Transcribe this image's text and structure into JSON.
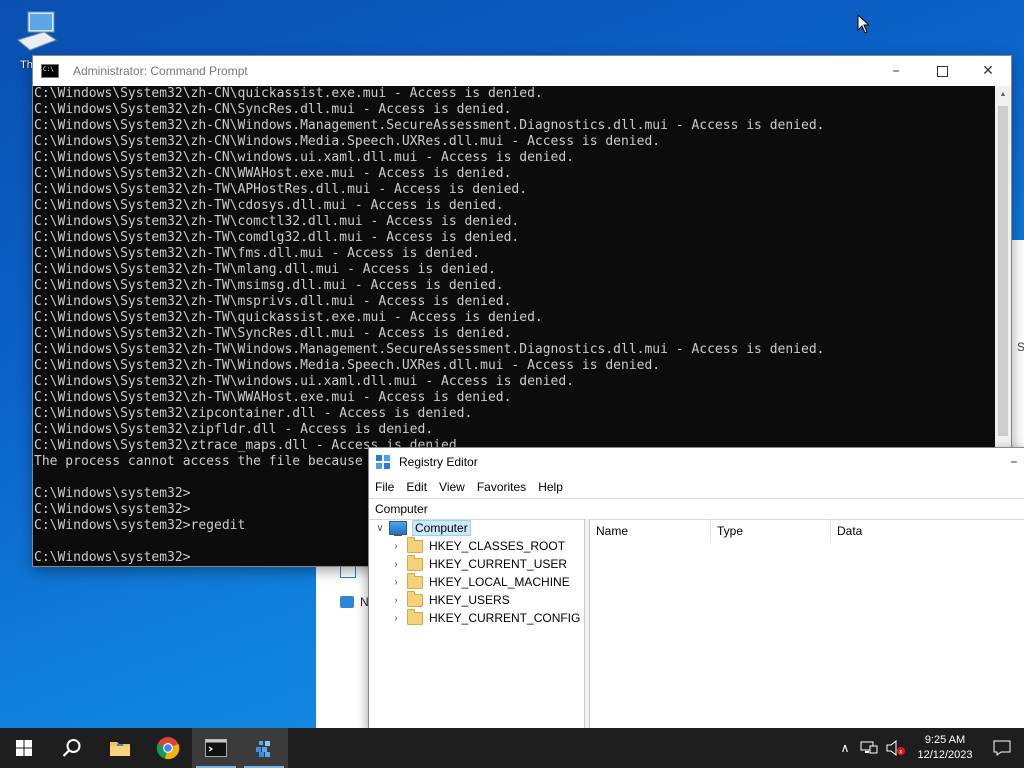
{
  "desktop": {
    "icon_label": "Th"
  },
  "cmd": {
    "title": "Administrator: Command Prompt",
    "lines": [
      "C:\\Windows\\System32\\zh-CN\\quickassist.exe.mui - Access is denied.",
      "C:\\Windows\\System32\\zh-CN\\SyncRes.dll.mui - Access is denied.",
      "C:\\Windows\\System32\\zh-CN\\Windows.Management.SecureAssessment.Diagnostics.dll.mui - Access is denied.",
      "C:\\Windows\\System32\\zh-CN\\Windows.Media.Speech.UXRes.dll.mui - Access is denied.",
      "C:\\Windows\\System32\\zh-CN\\windows.ui.xaml.dll.mui - Access is denied.",
      "C:\\Windows\\System32\\zh-CN\\WWAHost.exe.mui - Access is denied.",
      "C:\\Windows\\System32\\zh-TW\\APHostRes.dll.mui - Access is denied.",
      "C:\\Windows\\System32\\zh-TW\\cdosys.dll.mui - Access is denied.",
      "C:\\Windows\\System32\\zh-TW\\comctl32.dll.mui - Access is denied.",
      "C:\\Windows\\System32\\zh-TW\\comdlg32.dll.mui - Access is denied.",
      "C:\\Windows\\System32\\zh-TW\\fms.dll.mui - Access is denied.",
      "C:\\Windows\\System32\\zh-TW\\mlang.dll.mui - Access is denied.",
      "C:\\Windows\\System32\\zh-TW\\msimsg.dll.mui - Access is denied.",
      "C:\\Windows\\System32\\zh-TW\\msprivs.dll.mui - Access is denied.",
      "C:\\Windows\\System32\\zh-TW\\quickassist.exe.mui - Access is denied.",
      "C:\\Windows\\System32\\zh-TW\\SyncRes.dll.mui - Access is denied.",
      "C:\\Windows\\System32\\zh-TW\\Windows.Management.SecureAssessment.Diagnostics.dll.mui - Access is denied.",
      "C:\\Windows\\System32\\zh-TW\\Windows.Media.Speech.UXRes.dll.mui - Access is denied.",
      "C:\\Windows\\System32\\zh-TW\\windows.ui.xaml.dll.mui - Access is denied.",
      "C:\\Windows\\System32\\zh-TW\\WWAHost.exe.mui - Access is denied.",
      "C:\\Windows\\System32\\zipcontainer.dll - Access is denied.",
      "C:\\Windows\\System32\\zipfldr.dll - Access is denied.",
      "C:\\Windows\\System32\\ztrace_maps.dll - Access is denied.",
      "The process cannot access the file because",
      "",
      "C:\\Windows\\system32>",
      "C:\\Windows\\system32>",
      "C:\\Windows\\system32>regedit",
      "",
      "C:\\Windows\\system32>"
    ]
  },
  "behind": {
    "right_letter": "S",
    "left_letter": "N"
  },
  "regedit": {
    "title": "Registry Editor",
    "menu": [
      "File",
      "Edit",
      "View",
      "Favorites",
      "Help"
    ],
    "address": "Computer",
    "tree_root": "Computer",
    "hives": [
      "HKEY_CLASSES_ROOT",
      "HKEY_CURRENT_USER",
      "HKEY_LOCAL_MACHINE",
      "HKEY_USERS",
      "HKEY_CURRENT_CONFIG"
    ],
    "columns": [
      "Name",
      "Type",
      "Data"
    ]
  },
  "taskbar": {
    "time": "9:25 AM",
    "date": "12/12/2023"
  },
  "colors": {
    "accent": "#0078d7",
    "console_bg": "#0c0c0c",
    "console_fg": "#cccccc"
  }
}
